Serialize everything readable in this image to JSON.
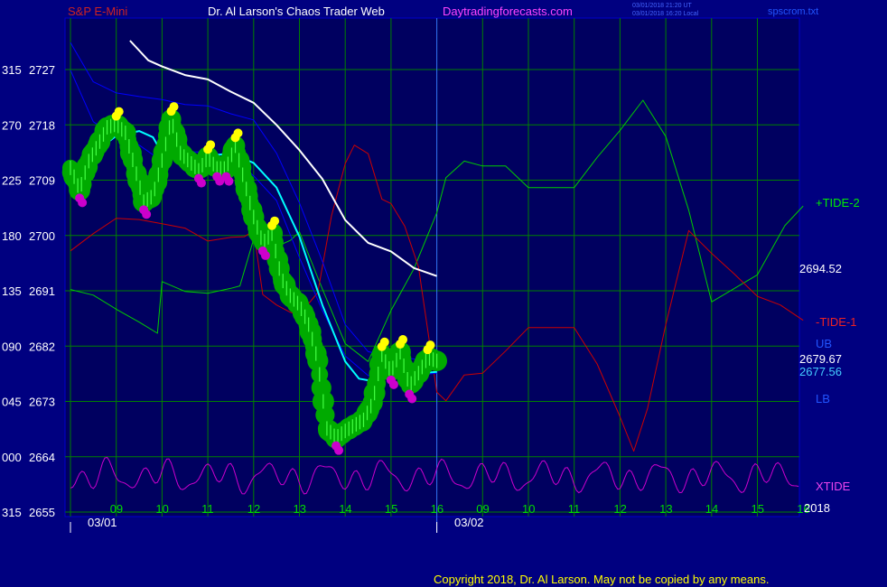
{
  "header": {
    "symbol": "S&P E-Mini",
    "title": "Dr. Al Larson's Chaos Trader Web",
    "site": "Daytradingforecasts.com",
    "stamp1": "03/01/2018 21:20 UT",
    "stamp2": "03/01/2018 16:20 Local",
    "file": "spscrom.txt"
  },
  "footer": {
    "copyright": "Copyright 2018, Dr. Al Larson. May not be copied by any means."
  },
  "colors": {
    "background": "#000080",
    "plot_bg": "#000060",
    "grid": "#008000",
    "tide_plus": "#00cc00",
    "tide_minus": "#cc0000",
    "xtide": "#cc00cc",
    "ma_white": "#ffffff",
    "ma_cyan": "#00ffff",
    "band_blue": "#0000ff",
    "price": "#ffff00",
    "yellow_dot": "#ffff00",
    "magenta_dot": "#cc00cc",
    "green_band": "#00aa00"
  },
  "chart_data": {
    "type": "line",
    "y_ticks": [
      {
        "left": "315",
        "price": "2727"
      },
      {
        "left": "270",
        "price": "2718"
      },
      {
        "left": "225",
        "price": "2709"
      },
      {
        "left": "180",
        "price": "2700"
      },
      {
        "left": "135",
        "price": "2691"
      },
      {
        "left": "090",
        "price": "2682"
      },
      {
        "left": "045",
        "price": "2673"
      },
      {
        "left": "000",
        "price": "2664"
      },
      {
        "left": "315",
        "price": "2655"
      }
    ],
    "ylim": [
      2655,
      2727
    ],
    "x_ticks_day1": [
      "09",
      "10",
      "11",
      "12",
      "13",
      "14",
      "15",
      "16"
    ],
    "x_ticks_day2": [
      "09",
      "10",
      "11",
      "12",
      "13",
      "14",
      "15",
      "16"
    ],
    "date_labels": [
      "03/01",
      "03/02"
    ],
    "year": "2018",
    "value_labels": {
      "last": "2694.52",
      "ub": "2679.67",
      "lb": "2677.56"
    },
    "series": [
      {
        "name": "+TIDE-2",
        "hour": [
          8.0,
          8.5,
          9.0,
          9.5,
          9.9,
          10.0,
          10.5,
          11.0,
          11.5,
          11.7,
          12.0,
          12.3,
          12.5,
          12.8,
          13.0,
          13.5,
          14.0,
          14.5,
          15.0,
          15.5,
          16.0,
          16.2,
          16.6,
          17.0,
          17.5,
          18.0,
          18.5,
          19.0,
          19.5,
          20.0,
          20.5,
          21.0,
          21.5,
          22.0,
          22.5,
          23.0,
          23.6,
          24.0
        ],
        "values": [
          2691.2,
          2690.3,
          2688.0,
          2685.9,
          2684.1,
          2692.5,
          2690.9,
          2690.6,
          2691.4,
          2691.8,
          2699.4,
          2700.8,
          2698.2,
          2699.2,
          2700.6,
          2691.3,
          2682.4,
          2679.5,
          2687.8,
          2694.6,
          2703.7,
          2709.4,
          2712.1,
          2711.3,
          2711.3,
          2707.8,
          2707.8,
          2707.8,
          2712.7,
          2717.1,
          2722.0,
          2716.1,
          2704.1,
          2689.2,
          2691.4,
          2693.6,
          2701.6,
          2704.8
        ],
        "label": "+TIDE-2"
      },
      {
        "name": "-TIDE-1",
        "hour": [
          8.0,
          8.5,
          9.0,
          9.5,
          10.0,
          10.5,
          11.0,
          11.5,
          11.8,
          12.0,
          12.2,
          12.5,
          12.8,
          13.0,
          13.4,
          13.7,
          14.0,
          14.2,
          14.5,
          14.8,
          15.0,
          15.3,
          15.6,
          16.0,
          16.2,
          16.6,
          17.0,
          17.5,
          18.0,
          18.5,
          19.0,
          19.5,
          20.0,
          20.3,
          20.6,
          21.0,
          21.5,
          22.0,
          22.5,
          23.0,
          23.5,
          24.0
        ],
        "values": [
          2697.5,
          2700.3,
          2702.8,
          2702.6,
          2701.9,
          2701.2,
          2699.1,
          2699.7,
          2699.8,
          2700.8,
          2690.4,
          2688.7,
          2687.5,
          2687.1,
          2690.7,
          2703.2,
          2711.7,
          2714.7,
          2713.3,
          2705.9,
          2705.2,
          2701.5,
          2694.9,
          2674.5,
          2673.1,
          2677.3,
          2677.6,
          2681.2,
          2685.0,
          2685.0,
          2685.0,
          2679.1,
          2670.5,
          2664.9,
          2671.8,
          2685.5,
          2700.8,
          2697.1,
          2693.7,
          2690.1,
          2688.7,
          2686.2
        ],
        "label": "-TIDE-1"
      },
      {
        "name": "XTIDE",
        "label": "XTIDE"
      },
      {
        "name": "MA-white",
        "hour": [
          9.3,
          9.7,
          10.0,
          10.5,
          11.0,
          11.5,
          12.0,
          12.5,
          13.0,
          13.5,
          14.0,
          14.5,
          15.0,
          15.5,
          16.0
        ],
        "values": [
          2731.7,
          2728.5,
          2727.5,
          2726.1,
          2725.4,
          2723.4,
          2721.6,
          2718.0,
          2713.9,
          2709.2,
          2702.5,
          2698.8,
          2697.4,
          2694.7,
          2693.4
        ]
      },
      {
        "name": "MA-cyan",
        "hour": [
          8.0,
          8.5,
          9.0,
          9.5,
          9.8,
          10.0,
          10.5,
          11.0,
          11.5,
          12.0,
          12.5,
          13.0,
          13.5,
          14.0,
          14.3,
          14.6,
          15.0,
          15.5,
          16.0
        ],
        "values": [
          2708.3,
          2713.4,
          2716.2,
          2717.0,
          2716.0,
          2713.4,
          2712.7,
          2712.9,
          2713.4,
          2711.8,
          2707.8,
          2699.8,
          2688.7,
          2679.5,
          2676.7,
          2676.3,
          2677.3,
          2677.5,
          2677.8
        ]
      },
      {
        "name": "UB",
        "hour": [
          8.0,
          8.5,
          9.0,
          9.5,
          10.0,
          10.5,
          11.0,
          11.5,
          12.0,
          12.5,
          13.0,
          13.5,
          14.0,
          14.5,
          15.0,
          15.5,
          16.0
        ],
        "values": [
          2731.4,
          2725.0,
          2723.2,
          2722.6,
          2722.1,
          2721.3,
          2721.1,
          2719.8,
          2718.8,
          2713.4,
          2705.3,
          2695.8,
          2685.5,
          2681.1,
          2680.3,
          2679.9,
          2679.7
        ]
      },
      {
        "name": "LB",
        "hour": [
          8.0,
          8.5,
          9.0,
          9.5,
          10.0,
          10.5,
          11.0,
          11.5,
          12.0,
          12.5,
          13.0,
          13.5,
          14.0,
          14.5,
          15.0,
          15.5,
          16.0
        ],
        "values": [
          2726.9,
          2718.5,
          2716.0,
          2714.7,
          2712.1,
          2713.6,
          2713.6,
          2712.9,
          2709.7,
          2705.7,
          2696.4,
          2687.8,
          2680.4,
          2677.2,
          2676.8,
          2677.2,
          2677.6
        ]
      },
      {
        "name": "Price",
        "hour": [
          8.0,
          8.2,
          8.4,
          8.6,
          8.8,
          9.0,
          9.2,
          9.4,
          9.6,
          9.8,
          10.0,
          10.2,
          10.4,
          10.6,
          10.8,
          11.0,
          11.2,
          11.4,
          11.6,
          11.8,
          12.0,
          12.2,
          12.4,
          12.6,
          12.8,
          13.0,
          13.2,
          13.4,
          13.6,
          13.8,
          14.0,
          14.2,
          14.4,
          14.6,
          14.8,
          15.0,
          15.2,
          15.4,
          15.6,
          15.8,
          16.0
        ],
        "values": [
          2711.0,
          2707.4,
          2712.1,
          2714.7,
          2717.6,
          2718.1,
          2716.7,
          2711.2,
          2705.5,
          2706.4,
          2712.2,
          2718.9,
          2713.4,
          2712.0,
          2710.6,
          2712.7,
          2710.9,
          2710.9,
          2714.6,
          2708.7,
          2703.0,
          2698.8,
          2700.3,
          2693.2,
          2690.2,
          2688.7,
          2685.5,
          2679.6,
          2668.6,
          2667.1,
          2668.2,
          2669.1,
          2670.0,
          2672.8,
          2680.6,
          2677.8,
          2681.0,
          2675.5,
          2677.6,
          2680.1,
          2679.6
        ]
      }
    ]
  }
}
